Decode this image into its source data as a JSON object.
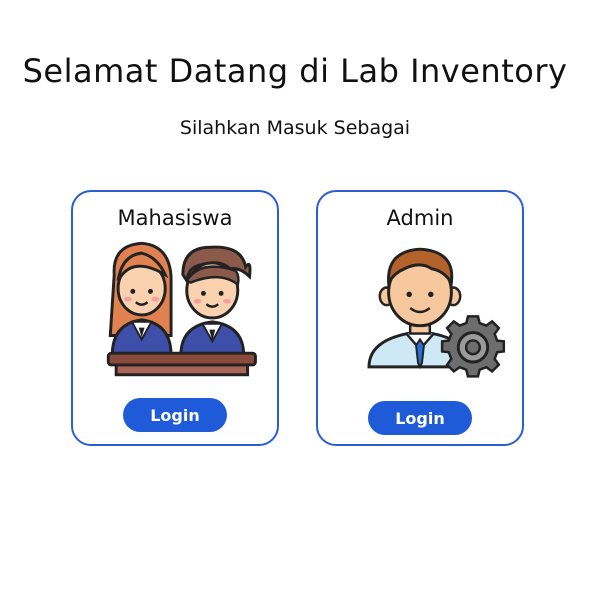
{
  "header": {
    "title": "Selamat Datang di Lab Inventory",
    "subtitle": "Silahkan Masuk Sebagai"
  },
  "roles": [
    {
      "label": "Mahasiswa",
      "button_label": "Login",
      "icon": "students-icon"
    },
    {
      "label": "Admin",
      "button_label": "Login",
      "icon": "admin-gear-icon"
    }
  ],
  "colors": {
    "accent": "#1f5bd8",
    "card_border": "#2a5fd1"
  }
}
